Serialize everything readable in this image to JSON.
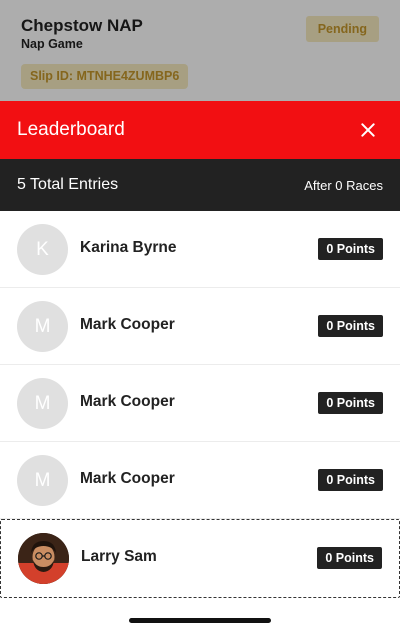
{
  "background": {
    "title": "Chepstow NAP",
    "subtitle": "Nap Game",
    "slip": "Slip ID: MTNHE4ZUMBP6",
    "status": "Pending"
  },
  "leaderboard": {
    "title": "Leaderboard",
    "total_entries": "5 Total Entries",
    "after_races": "After 0 Races",
    "entries": [
      {
        "initial": "K",
        "name": "Karina Byrne",
        "points": "0 Points"
      },
      {
        "initial": "M",
        "name": "Mark Cooper",
        "points": "0 Points"
      },
      {
        "initial": "M",
        "name": "Mark Cooper",
        "points": "0 Points"
      },
      {
        "initial": "M",
        "name": "Mark Cooper",
        "points": "0 Points"
      },
      {
        "initial": "",
        "name": "Larry Sam",
        "points": "0 Points"
      }
    ]
  },
  "colors": {
    "header_red": "#f20f12",
    "summary_dark": "#222222",
    "badge_gold": "#c4972b"
  }
}
